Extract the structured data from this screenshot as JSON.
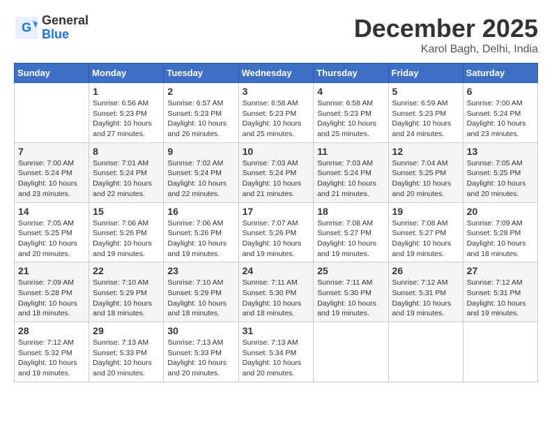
{
  "logo": {
    "general": "General",
    "blue": "Blue"
  },
  "title": "December 2025",
  "subtitle": "Karol Bagh, Delhi, India",
  "days_of_week": [
    "Sunday",
    "Monday",
    "Tuesday",
    "Wednesday",
    "Thursday",
    "Friday",
    "Saturday"
  ],
  "weeks": [
    [
      {
        "day": "",
        "info": ""
      },
      {
        "day": "1",
        "info": "Sunrise: 6:56 AM\nSunset: 5:23 PM\nDaylight: 10 hours\nand 27 minutes."
      },
      {
        "day": "2",
        "info": "Sunrise: 6:57 AM\nSunset: 5:23 PM\nDaylight: 10 hours\nand 26 minutes."
      },
      {
        "day": "3",
        "info": "Sunrise: 6:58 AM\nSunset: 5:23 PM\nDaylight: 10 hours\nand 25 minutes."
      },
      {
        "day": "4",
        "info": "Sunrise: 6:58 AM\nSunset: 5:23 PM\nDaylight: 10 hours\nand 25 minutes."
      },
      {
        "day": "5",
        "info": "Sunrise: 6:59 AM\nSunset: 5:23 PM\nDaylight: 10 hours\nand 24 minutes."
      },
      {
        "day": "6",
        "info": "Sunrise: 7:00 AM\nSunset: 5:24 PM\nDaylight: 10 hours\nand 23 minutes."
      }
    ],
    [
      {
        "day": "7",
        "info": "Sunrise: 7:00 AM\nSunset: 5:24 PM\nDaylight: 10 hours\nand 23 minutes."
      },
      {
        "day": "8",
        "info": "Sunrise: 7:01 AM\nSunset: 5:24 PM\nDaylight: 10 hours\nand 22 minutes."
      },
      {
        "day": "9",
        "info": "Sunrise: 7:02 AM\nSunset: 5:24 PM\nDaylight: 10 hours\nand 22 minutes."
      },
      {
        "day": "10",
        "info": "Sunrise: 7:03 AM\nSunset: 5:24 PM\nDaylight: 10 hours\nand 21 minutes."
      },
      {
        "day": "11",
        "info": "Sunrise: 7:03 AM\nSunset: 5:24 PM\nDaylight: 10 hours\nand 21 minutes."
      },
      {
        "day": "12",
        "info": "Sunrise: 7:04 AM\nSunset: 5:25 PM\nDaylight: 10 hours\nand 20 minutes."
      },
      {
        "day": "13",
        "info": "Sunrise: 7:05 AM\nSunset: 5:25 PM\nDaylight: 10 hours\nand 20 minutes."
      }
    ],
    [
      {
        "day": "14",
        "info": "Sunrise: 7:05 AM\nSunset: 5:25 PM\nDaylight: 10 hours\nand 20 minutes."
      },
      {
        "day": "15",
        "info": "Sunrise: 7:06 AM\nSunset: 5:26 PM\nDaylight: 10 hours\nand 19 minutes."
      },
      {
        "day": "16",
        "info": "Sunrise: 7:06 AM\nSunset: 5:26 PM\nDaylight: 10 hours\nand 19 minutes."
      },
      {
        "day": "17",
        "info": "Sunrise: 7:07 AM\nSunset: 5:26 PM\nDaylight: 10 hours\nand 19 minutes."
      },
      {
        "day": "18",
        "info": "Sunrise: 7:08 AM\nSunset: 5:27 PM\nDaylight: 10 hours\nand 19 minutes."
      },
      {
        "day": "19",
        "info": "Sunrise: 7:08 AM\nSunset: 5:27 PM\nDaylight: 10 hours\nand 19 minutes."
      },
      {
        "day": "20",
        "info": "Sunrise: 7:09 AM\nSunset: 5:28 PM\nDaylight: 10 hours\nand 18 minutes."
      }
    ],
    [
      {
        "day": "21",
        "info": "Sunrise: 7:09 AM\nSunset: 5:28 PM\nDaylight: 10 hours\nand 18 minutes."
      },
      {
        "day": "22",
        "info": "Sunrise: 7:10 AM\nSunset: 5:29 PM\nDaylight: 10 hours\nand 18 minutes."
      },
      {
        "day": "23",
        "info": "Sunrise: 7:10 AM\nSunset: 5:29 PM\nDaylight: 10 hours\nand 18 minutes."
      },
      {
        "day": "24",
        "info": "Sunrise: 7:11 AM\nSunset: 5:30 PM\nDaylight: 10 hours\nand 18 minutes."
      },
      {
        "day": "25",
        "info": "Sunrise: 7:11 AM\nSunset: 5:30 PM\nDaylight: 10 hours\nand 19 minutes."
      },
      {
        "day": "26",
        "info": "Sunrise: 7:12 AM\nSunset: 5:31 PM\nDaylight: 10 hours\nand 19 minutes."
      },
      {
        "day": "27",
        "info": "Sunrise: 7:12 AM\nSunset: 5:31 PM\nDaylight: 10 hours\nand 19 minutes."
      }
    ],
    [
      {
        "day": "28",
        "info": "Sunrise: 7:12 AM\nSunset: 5:32 PM\nDaylight: 10 hours\nand 19 minutes."
      },
      {
        "day": "29",
        "info": "Sunrise: 7:13 AM\nSunset: 5:33 PM\nDaylight: 10 hours\nand 20 minutes."
      },
      {
        "day": "30",
        "info": "Sunrise: 7:13 AM\nSunset: 5:33 PM\nDaylight: 10 hours\nand 20 minutes."
      },
      {
        "day": "31",
        "info": "Sunrise: 7:13 AM\nSunset: 5:34 PM\nDaylight: 10 hours\nand 20 minutes."
      },
      {
        "day": "",
        "info": ""
      },
      {
        "day": "",
        "info": ""
      },
      {
        "day": "",
        "info": ""
      }
    ]
  ]
}
